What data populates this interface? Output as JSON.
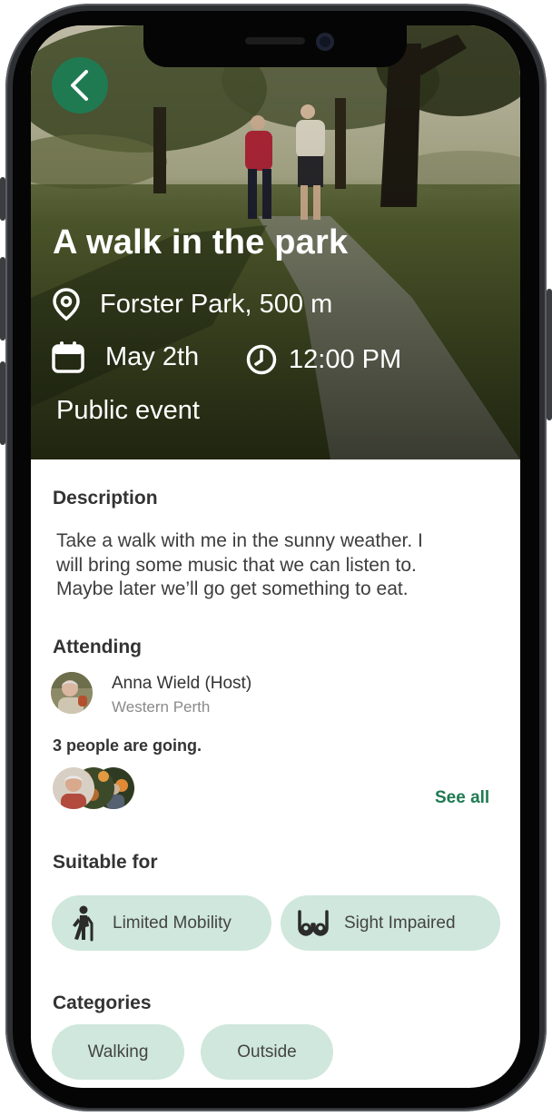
{
  "event": {
    "title": "A walk in the park",
    "location": "Forster Park, 500 m",
    "date": "May 2th",
    "time": "12:00 PM",
    "visibility": "Public event"
  },
  "description": {
    "heading": "Description",
    "lines": [
      "Take a walk with me in the sunny weather. I",
      "will bring some music that we can listen to.",
      "Maybe later we’ll go get something to eat."
    ]
  },
  "attending": {
    "heading": "Attending",
    "host_name": "Anna Wield (Host)",
    "host_location": "Western Perth",
    "going_text": "3 people are going.",
    "see_all_label": "See all"
  },
  "suitable_for": {
    "heading": "Suitable for",
    "items": [
      {
        "label": "Limited Mobility",
        "icon": "walking-cane-person-icon"
      },
      {
        "label": "Sight Impaired",
        "icon": "glasses-icon"
      }
    ]
  },
  "categories": {
    "heading": "Categories",
    "items": [
      {
        "label": "Walking"
      },
      {
        "label": "Outside"
      }
    ]
  },
  "colors": {
    "accent": "#1f7a52",
    "chip_bg": "#cfe7dc",
    "text_dark": "#333333",
    "text_muted": "#8a8a8a"
  },
  "icons": {
    "back": "chevron-left-icon",
    "location": "location-pin-icon",
    "date": "calendar-icon",
    "time": "clock-icon"
  }
}
